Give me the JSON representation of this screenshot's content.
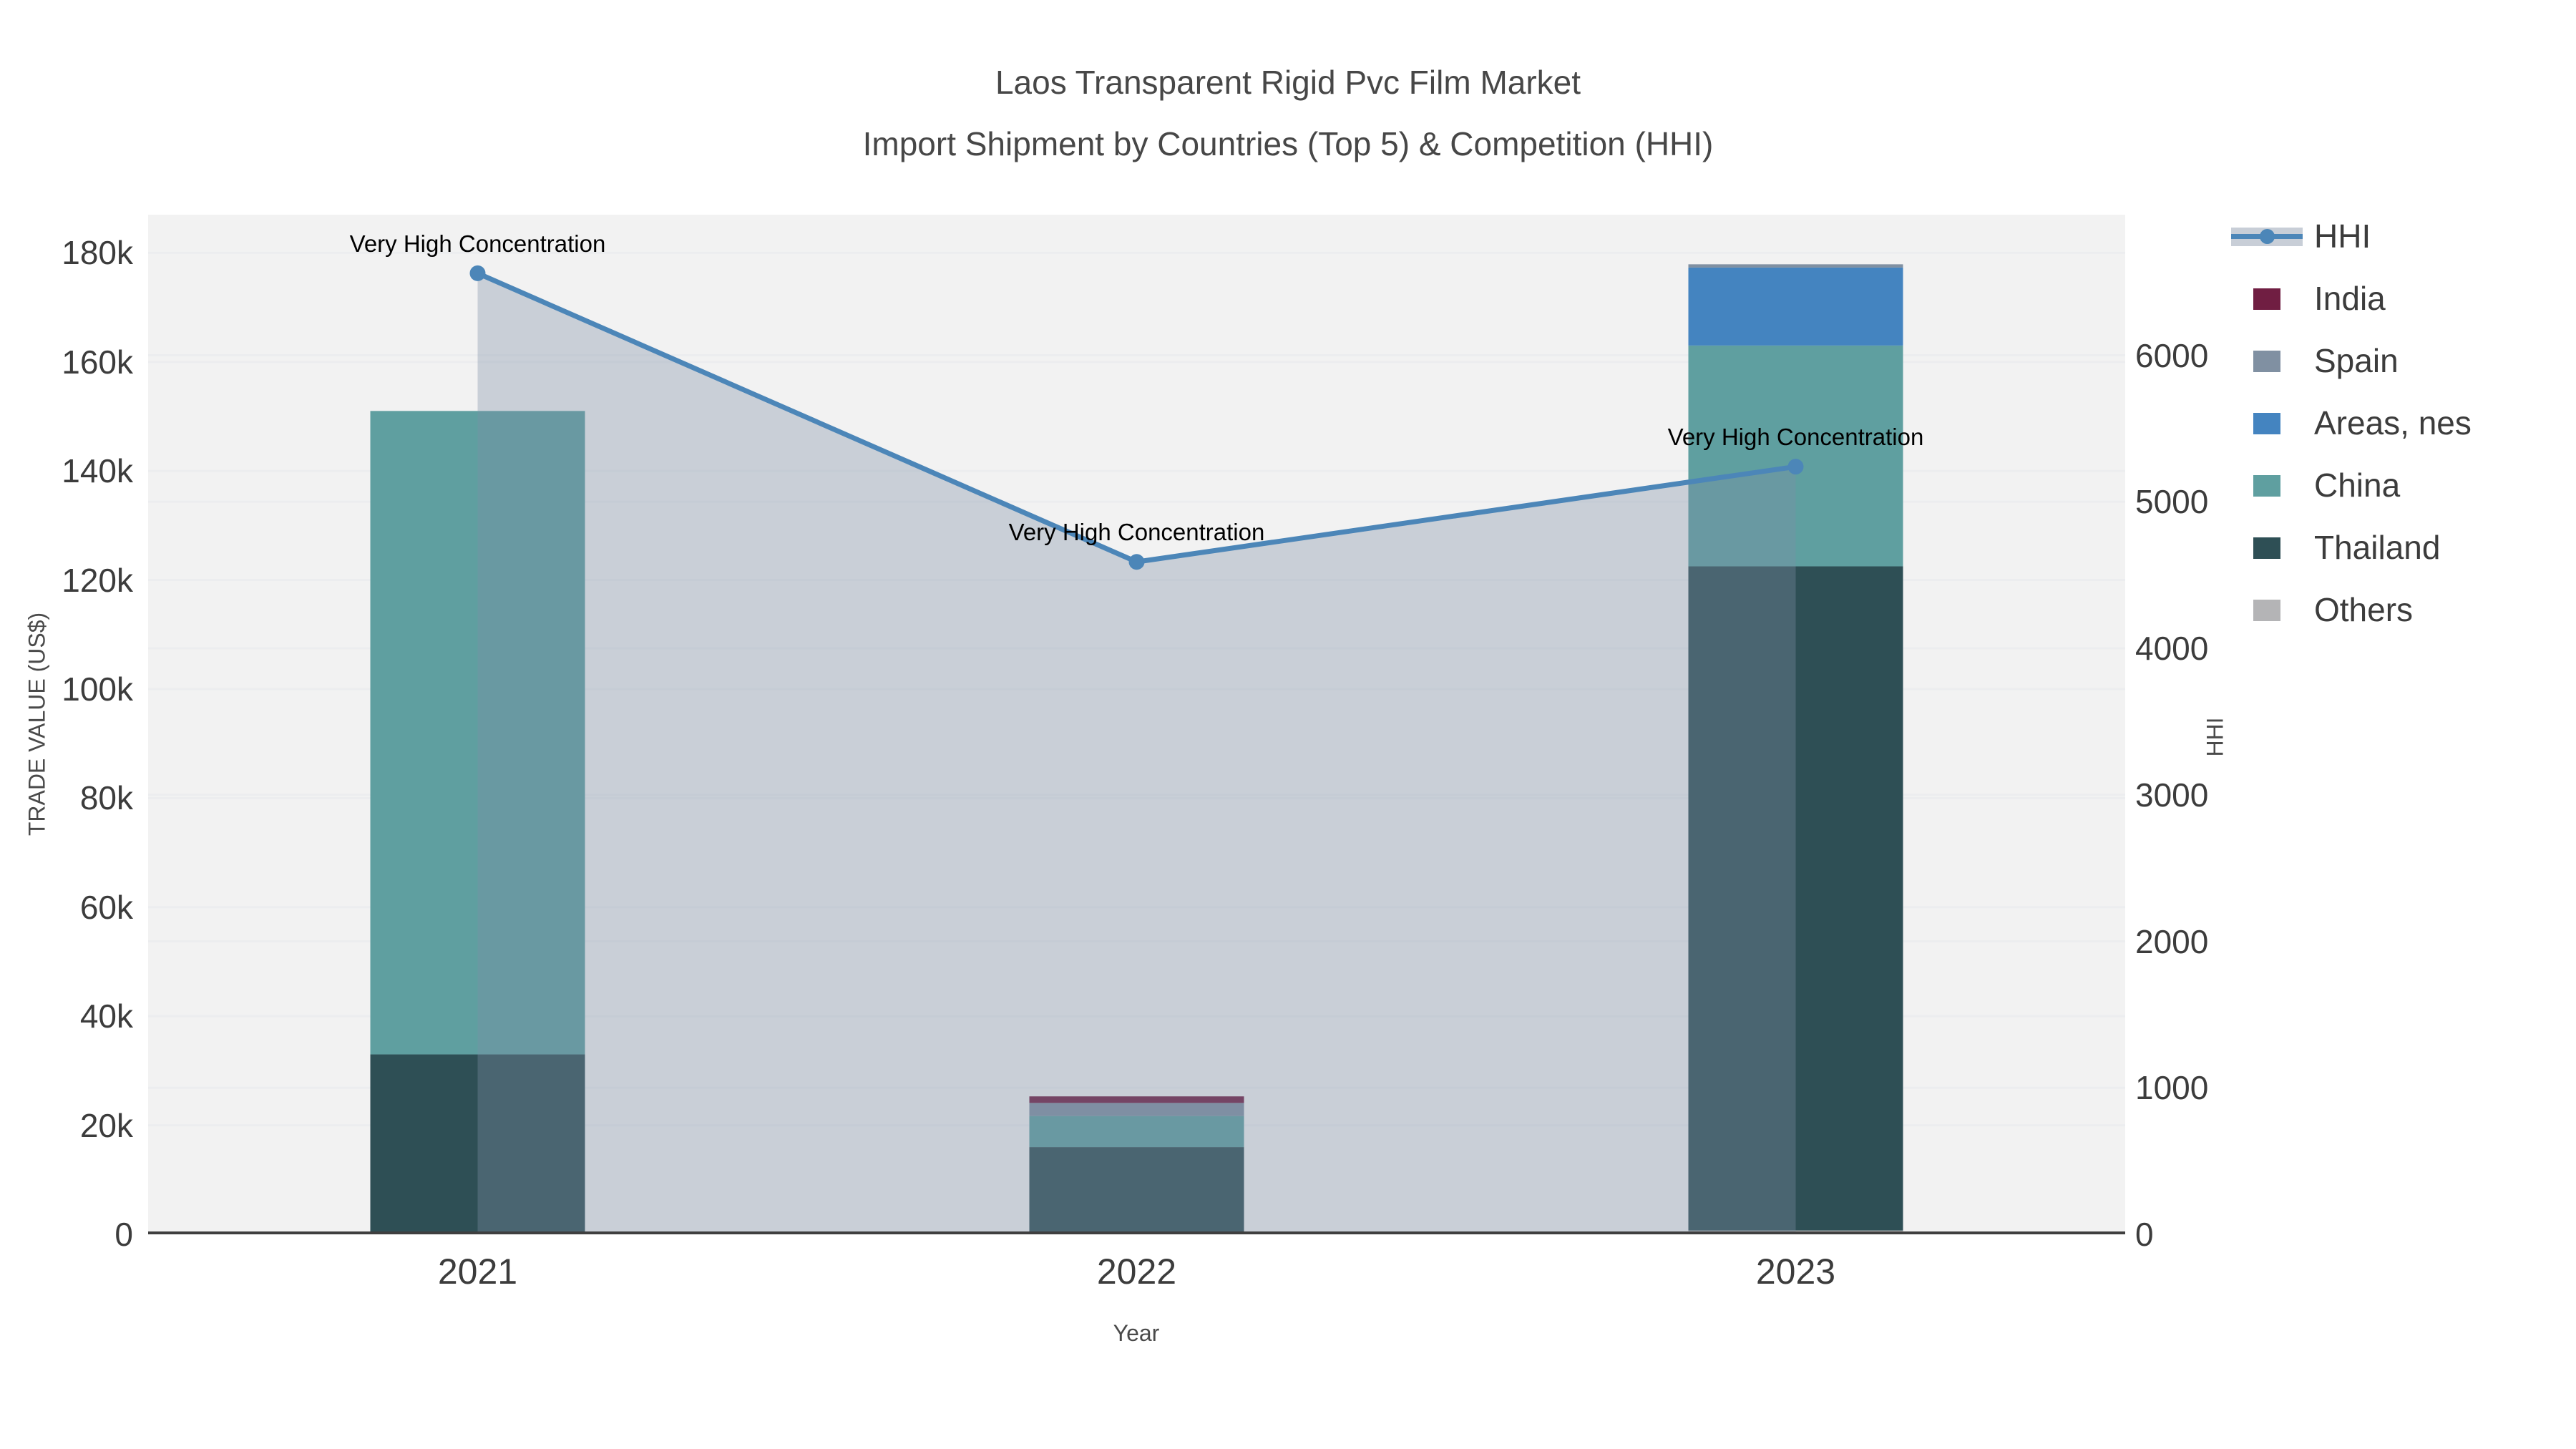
{
  "title": {
    "line1": "Laos Transparent Rigid Pvc Film Market",
    "line2": "Import Shipment by Countries (Top 5) & Competition (HHI)"
  },
  "axes": {
    "x": {
      "title": "Year",
      "ticks": [
        "2021",
        "2022",
        "2023"
      ]
    },
    "y_left": {
      "title": "TRADE VALUE (US$)",
      "tick_values": [
        0,
        20000,
        40000,
        60000,
        80000,
        100000,
        120000,
        140000,
        160000,
        180000
      ],
      "tick_labels": [
        "0",
        "20k",
        "40k",
        "60k",
        "80k",
        "100k",
        "120k",
        "140k",
        "160k",
        "180k"
      ]
    },
    "y_right": {
      "title": "HHI",
      "tick_values": [
        0,
        1000,
        2000,
        3000,
        4000,
        5000,
        6000
      ],
      "tick_labels": [
        "0",
        "1000",
        "2000",
        "3000",
        "4000",
        "5000",
        "6000"
      ]
    }
  },
  "legend": [
    {
      "label": "HHI",
      "type": "line"
    },
    {
      "label": "India",
      "type": "swatch",
      "color": "#701E42"
    },
    {
      "label": "Spain",
      "type": "swatch",
      "color": "#8090A2"
    },
    {
      "label": "Areas, nes",
      "type": "swatch",
      "color": "#4484C0"
    },
    {
      "label": "China",
      "type": "swatch",
      "color": "#5F9FA0"
    },
    {
      "label": "Thailand",
      "type": "swatch",
      "color": "#2E4F55"
    },
    {
      "label": "Others",
      "type": "swatch",
      "color": "#B4B4B6"
    }
  ],
  "colors": {
    "hhi_line": "#4C86B8",
    "hhi_area": "rgba(127,144,167,0.35)",
    "plot_bg": "#F2F2F2",
    "grid": "#ECEDEF",
    "axis_line": "#3F3F3F",
    "annotation_text": "#000000"
  },
  "chart_data": {
    "type": "bar",
    "subtype": "stacked-bars-with-line-dual-axis",
    "title": "Laos Transparent Rigid Pvc Film Market — Import Shipment by Countries (Top 5) & Competition (HHI)",
    "categories": [
      "2021",
      "2022",
      "2023"
    ],
    "xlabel": "Year",
    "ylabel_left": "TRADE VALUE (US$)",
    "ylabel_right": "HHI",
    "ylim_left": [
      0,
      187000
    ],
    "ylim_right": [
      0,
      6960
    ],
    "grid": true,
    "legend_position": "right",
    "bar_stack_order_bottom_to_top": [
      "Others",
      "Thailand",
      "China",
      "Areas, nes",
      "Spain",
      "India"
    ],
    "series": [
      {
        "name": "Others",
        "color": "#B4B4B6",
        "values": [
          0,
          0,
          700
        ]
      },
      {
        "name": "Thailand",
        "color": "#2E4F55",
        "values": [
          33000,
          16000,
          121800
        ]
      },
      {
        "name": "China",
        "color": "#5F9FA0",
        "values": [
          118000,
          5700,
          40500
        ]
      },
      {
        "name": "Areas, nes",
        "color": "#4484C0",
        "values": [
          0,
          0,
          14300
        ]
      },
      {
        "name": "Spain",
        "color": "#8090A2",
        "values": [
          0,
          2400,
          600
        ]
      },
      {
        "name": "India",
        "color": "#701E42",
        "values": [
          0,
          1200,
          0
        ]
      }
    ],
    "bar_totals": [
      151000,
      25300,
      177900
    ],
    "line_series": {
      "name": "HHI",
      "axis": "right",
      "values": [
        6560,
        4590,
        5240
      ]
    },
    "annotations": [
      "Very High Concentration",
      "Very High Concentration",
      "Very High Concentration"
    ]
  }
}
